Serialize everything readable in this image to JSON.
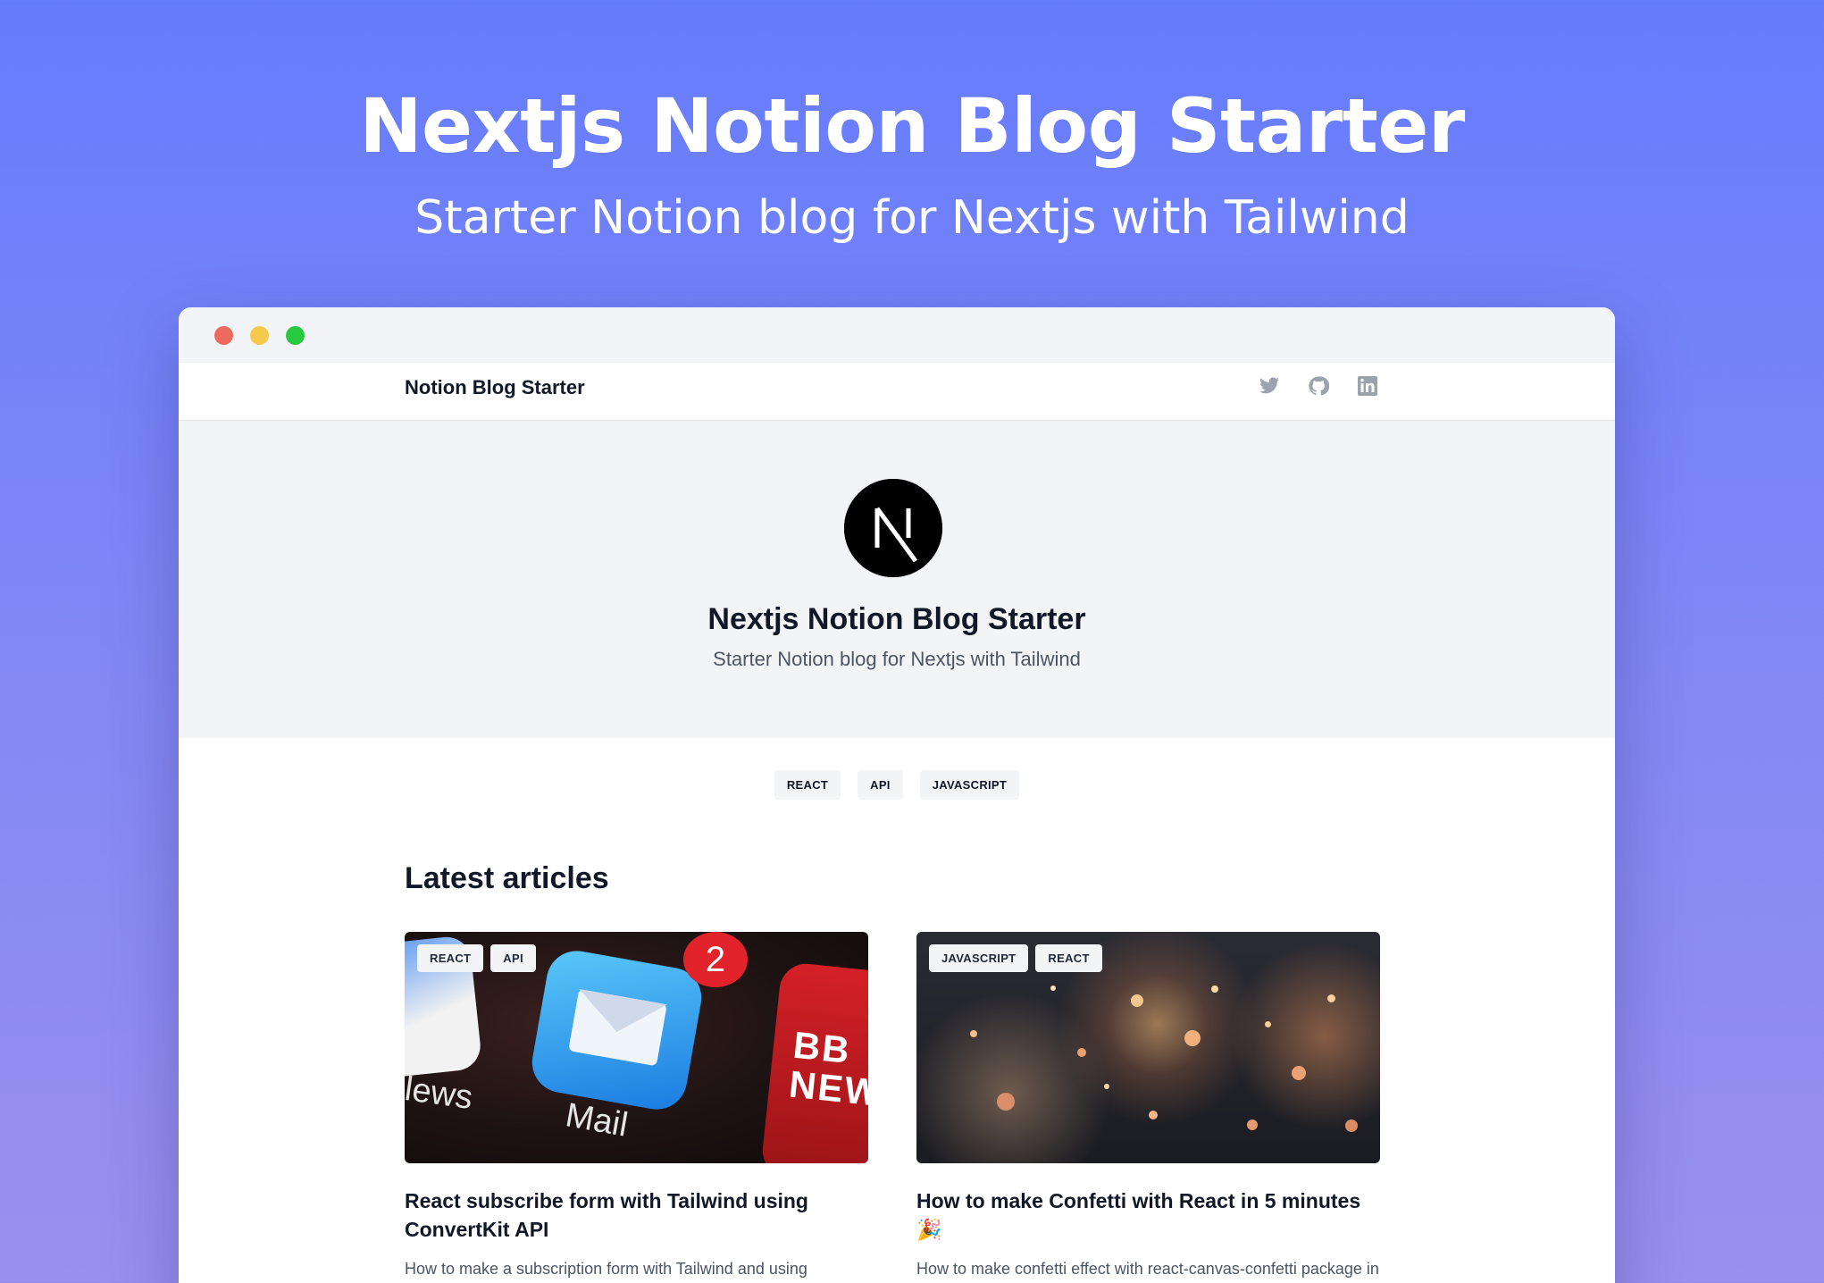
{
  "hero": {
    "title": "Nextjs Notion Blog Starter",
    "subtitle": "Starter Notion blog for Nextjs with Tailwind"
  },
  "window": {
    "traffic_lights": [
      "#ee6a5f",
      "#f5c94c",
      "#28c840"
    ]
  },
  "navbar": {
    "brand": "Notion Blog Starter",
    "socials": [
      {
        "name": "twitter-icon"
      },
      {
        "name": "github-icon"
      },
      {
        "name": "linkedin-icon"
      }
    ]
  },
  "profile": {
    "avatar_letter": "N",
    "name": "Nextjs Notion Blog Starter",
    "description": "Starter Notion blog for Nextjs with Tailwind"
  },
  "tags": [
    "REACT",
    "API",
    "JAVASCRIPT"
  ],
  "section_title": "Latest articles",
  "articles": [
    {
      "tags": [
        "REACT",
        "API"
      ],
      "title": "React subscribe form with Tailwind using ConvertKit API",
      "description": "How to make a subscription form with Tailwind and using",
      "image": {
        "badge": "2",
        "mail_label": "Mail",
        "news_label": "lews",
        "bbc_text": "BB\nNEW"
      }
    },
    {
      "tags": [
        "JAVASCRIPT",
        "REACT"
      ],
      "title": "How to make Confetti with React in 5 minutes 🎉",
      "description": "How to make confetti effect with react-canvas-confetti package in React."
    }
  ],
  "colors": {
    "accent": "#657cfd",
    "text": "#111827",
    "muted": "#4b5563"
  }
}
